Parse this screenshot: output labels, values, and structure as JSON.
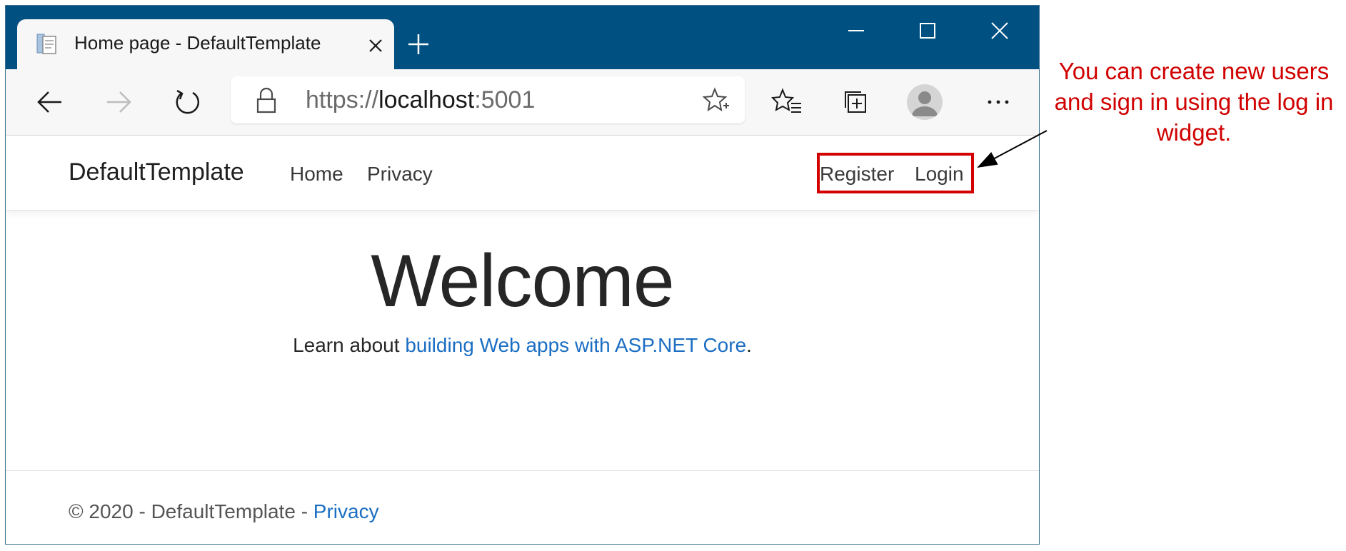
{
  "browser": {
    "tab_title": "Home page - DefaultTemplate",
    "url_scheme": "https://",
    "url_host": "localhost",
    "url_port": ":5001",
    "titlebar_color": "#005081"
  },
  "icons": [
    "page-favicon-icon",
    "close-tab-icon",
    "new-tab-icon",
    "minimize-icon",
    "maximize-icon",
    "close-window-icon",
    "back-icon",
    "forward-icon",
    "refresh-icon",
    "lock-icon",
    "favorite-star-icon",
    "favorites-icon",
    "collections-icon",
    "profile-avatar-icon",
    "more-icon"
  ],
  "site": {
    "brand": "DefaultTemplate",
    "nav": {
      "home": "Home",
      "privacy": "Privacy"
    },
    "auth": {
      "register": "Register",
      "login": "Login"
    },
    "heading": "Welcome",
    "learn_prefix": "Learn about ",
    "learn_link": "building Web apps with ASP.NET Core",
    "learn_suffix": ".",
    "footer_text": "© 2020 - DefaultTemplate - ",
    "footer_link": "Privacy",
    "link_color": "#1b6ec2"
  },
  "annotation": {
    "text": "You can create new users and sign in using the log in widget.",
    "color": "#d00000"
  }
}
